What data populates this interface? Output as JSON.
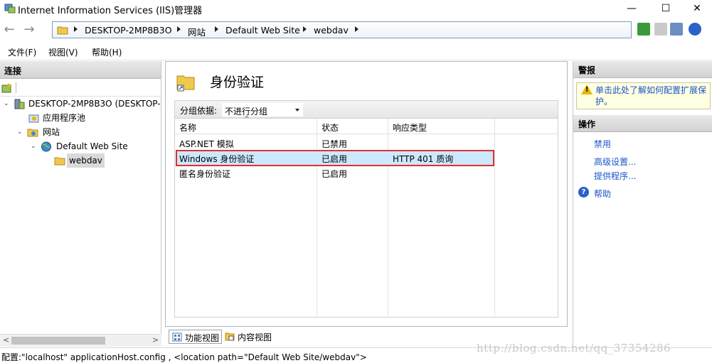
{
  "window": {
    "title": "Internet Information Services (IIS)管理器",
    "buttons": {
      "minimize": "—",
      "maximize": "☐",
      "close": "✕"
    }
  },
  "address_bar": {
    "back": "←",
    "forward": "→",
    "breadcrumb": [
      "DESKTOP-2MP8B3O",
      "网站",
      "Default Web Site",
      "webdav"
    ]
  },
  "menu": [
    "文件(F)",
    "视图(V)",
    "帮助(H)"
  ],
  "connections": {
    "header": "连接",
    "tree": [
      {
        "label": "DESKTOP-2MP8B3O (DESKTOP-",
        "icon": "server-icon",
        "expander": "⌄"
      },
      {
        "label": "应用程序池",
        "icon": "app-pool-icon",
        "expander": ""
      },
      {
        "label": "网站",
        "icon": "sites-folder-icon",
        "expander": "⌄"
      },
      {
        "label": "Default Web Site",
        "icon": "globe-icon",
        "expander": "⌄"
      },
      {
        "label": "webdav",
        "icon": "folder-icon",
        "expander": ""
      }
    ],
    "scroll_left": "<",
    "scroll_right": ">"
  },
  "feature": {
    "title": "身份验证",
    "group_by_label": "分组依据:",
    "group_by_value": "不进行分组",
    "sort_indicator": "^",
    "columns": [
      "名称",
      "状态",
      "响应类型"
    ],
    "rows": [
      {
        "name": "ASP.NET 模拟",
        "status": "已禁用",
        "response": ""
      },
      {
        "name": "Windows 身份验证",
        "status": "已启用",
        "response": "HTTP 401 质询"
      },
      {
        "name": "匿名身份验证",
        "status": "已启用",
        "response": ""
      }
    ],
    "selected_row": 1
  },
  "view_tabs": {
    "features": "功能视图",
    "content": "内容视图"
  },
  "actions": {
    "alerts_header": "警报",
    "alert_text": "单击此处了解如何配置扩展保护。",
    "actions_header": "操作",
    "links": [
      "禁用",
      "高级设置...",
      "提供程序..."
    ],
    "help": "帮助"
  },
  "status_bar": {
    "text": "配置:\"localhost\" applicationHost.config , <location path=\"Default Web Site/webdav\">"
  },
  "watermark": "http://blog.csdn.net/qq_37354286",
  "colors": {
    "selection": "#cce8ff",
    "highlight_border": "#e03030",
    "link": "#1a55cc",
    "alert_bg": "#ffffe1"
  }
}
